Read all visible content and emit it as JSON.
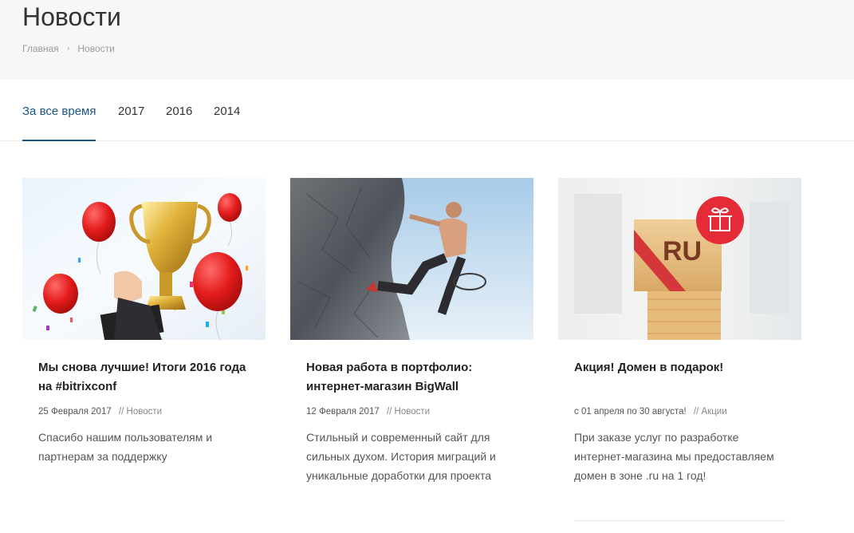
{
  "header": {
    "title": "Новости",
    "breadcrumb": [
      {
        "label": "Главная"
      },
      {
        "label": "Новости"
      }
    ]
  },
  "tabs": [
    {
      "label": "За все время",
      "active": true
    },
    {
      "label": "2017",
      "active": false
    },
    {
      "label": "2016",
      "active": false
    },
    {
      "label": "2014",
      "active": false
    }
  ],
  "news": [
    {
      "image": "trophy-with-balloons",
      "title": "Мы снова лучшие! Итоги 2016 года на #bitrixconf",
      "date": "25 Февраля 2017",
      "category": "// Новости",
      "text": "Спасибо нашим пользователям и партнерам за поддержку"
    },
    {
      "image": "rock-climber",
      "title": "Новая работа в портфолио: интернет-магазин BigWall",
      "date": "12 Февраля 2017",
      "category": "// Новости",
      "text": "Стильный и современный сайт для сильных духом. История миграций и уникальные доработки для проекта"
    },
    {
      "image": "ru-domain-gift-box",
      "image_label": "RU",
      "title": "Акция! Домен в подарок!",
      "date": "с 01 апреля по 30 августа!",
      "category": "// Акции",
      "text": "При заказе услуг по разработке интернет-магазина мы предоставляем домен в зоне .ru на 1 год!"
    }
  ],
  "colors": {
    "accent": "#1d5585",
    "header_bg": "#f7f7f7",
    "gift_badge": "#e52b38"
  }
}
